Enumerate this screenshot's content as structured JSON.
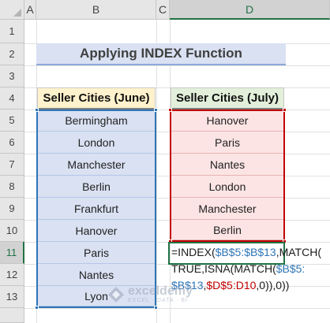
{
  "columns": [
    "A",
    "B",
    "C",
    "D"
  ],
  "rows": [
    "1",
    "2",
    "3",
    "4",
    "5",
    "6",
    "7",
    "8",
    "9",
    "10",
    "11",
    "12",
    "13"
  ],
  "active_cell": {
    "column": "D",
    "row": "11"
  },
  "title": "Applying INDEX Function",
  "june": {
    "header": "Seller Cities (June)",
    "cities": [
      "Bermingham",
      "London",
      "Manchester",
      "Berlin",
      "Frankfurt",
      "Hanover",
      "Paris",
      "Nantes",
      "Lyon"
    ]
  },
  "july": {
    "header": "Seller Cities (July)",
    "cities": [
      "Hanover",
      "Paris",
      "Nantes",
      "London",
      "Manchester",
      "Berlin"
    ]
  },
  "formula": {
    "line1_a": "=INDEX(",
    "line1_ref": "$B$5:$B$13",
    "line1_b": ",MATCH(",
    "line2_a": "TRUE,ISNA(MATCH(",
    "line2_ref": "$B$5:",
    "line3_ref1": "$B$13",
    "line3_comma": ",",
    "line3_ref2": "$D$5:D10",
    "line3_end": ",0)),0))"
  },
  "watermark": {
    "name": "exceldemy",
    "tagline": "EXCEL · DATA · BI"
  },
  "colors": {
    "accent_green": "#217346",
    "june_blue": "#2e75b6",
    "july_red": "#c00000"
  }
}
